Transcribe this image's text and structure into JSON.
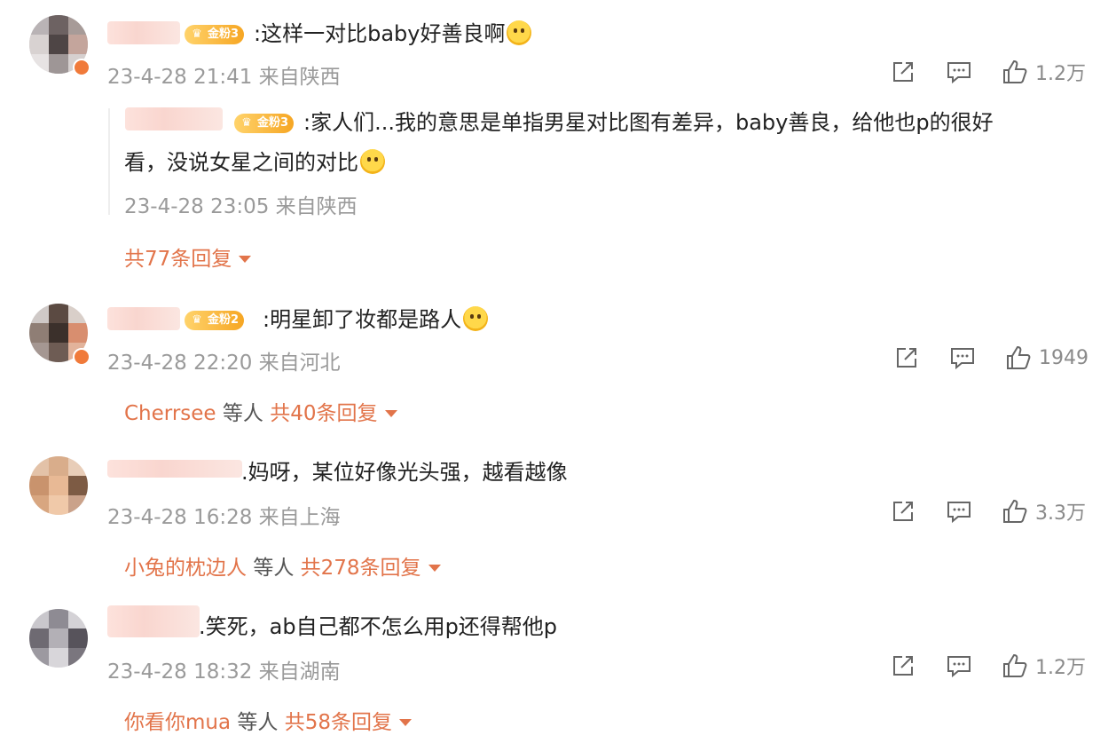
{
  "comments": [
    {
      "badge": "金粉3",
      "text": ":这样一对比baby好善良啊",
      "time": "23-4-28 21:41",
      "location": "来自陕西",
      "likes": "1.2万",
      "reply": {
        "badge": "金粉3",
        "text_line1": ":家人们...我的意思是单指男星对比图有差异，baby善良，给他也p的很好",
        "text_line2": "看，没说女星之间的对比",
        "time": "23-4-28 23:05",
        "location": "来自陕西"
      },
      "replies_total": "共77条回复"
    },
    {
      "badge": "金粉2",
      "text": ":明星卸了妆都是路人",
      "time": "23-4-28 22:20",
      "location": "来自河北",
      "likes": "1949",
      "replier": "Cherrsee",
      "and_others": "等人",
      "replies_total": "共40条回复"
    },
    {
      "text": ".妈呀，某位好像光头强，越看越像",
      "time": "23-4-28 16:28",
      "location": "来自上海",
      "likes": "3.3万",
      "replier": "小兔的枕边人",
      "and_others": "等人",
      "replies_total": "共278条回复"
    },
    {
      "text": ".笑死，ab自己都不怎么用p还得帮他p",
      "time": "23-4-28 18:32",
      "location": "来自湖南",
      "likes": "1.2万",
      "replier": "你看你mua",
      "and_others": "等人",
      "replies_total": "共58条回复"
    }
  ],
  "icons": {
    "share": "share-icon",
    "comment": "comment-icon",
    "like": "thumbs-up-icon"
  },
  "colors": {
    "accent": "#e2744a",
    "meta": "#9a9a9a",
    "badge": "#f6a623"
  }
}
